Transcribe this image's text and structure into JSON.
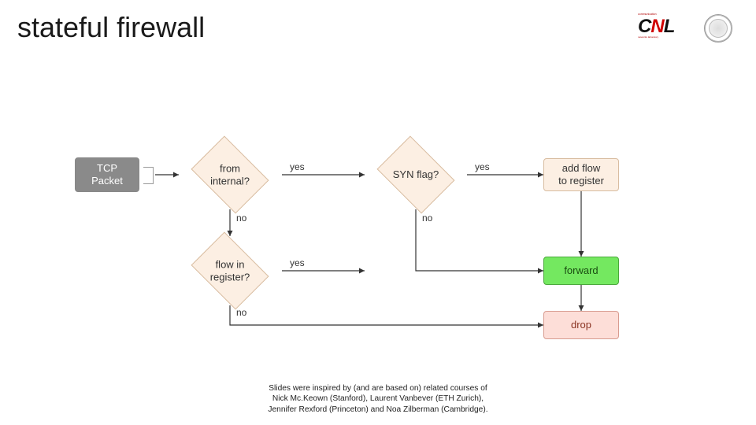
{
  "title": "stateful firewall",
  "logo": {
    "top_text": "communication",
    "name_c": "C",
    "name_n": "N",
    "name_l": "L",
    "sub_text": "networks laboratory"
  },
  "nodes": {
    "start": "TCP\nPacket",
    "decision_internal": "from\ninternal?",
    "decision_syn": "SYN flag?",
    "decision_register": "flow in\nregister?",
    "action_addflow": "add flow\nto register",
    "action_forward": "forward",
    "action_drop": "drop"
  },
  "edges": {
    "internal_yes": "yes",
    "internal_no": "no",
    "syn_yes": "yes",
    "syn_no": "no",
    "register_yes": "yes",
    "register_no": "no"
  },
  "footer": {
    "line1": "Slides were inspired by (and are based on) related courses of",
    "line2": "Nick Mc.Keown (Stanford), Laurent Vanbever (ETH Zurich),",
    "line3": "Jennifer Rexford (Princeton) and Noa Zilberman (Cambridge)."
  },
  "chart_data": {
    "type": "flowchart",
    "title": "stateful firewall",
    "nodes": [
      {
        "id": "start",
        "type": "start",
        "label": "TCP Packet"
      },
      {
        "id": "from_internal",
        "type": "decision",
        "label": "from internal?"
      },
      {
        "id": "syn_flag",
        "type": "decision",
        "label": "SYN flag?"
      },
      {
        "id": "flow_in_reg",
        "type": "decision",
        "label": "flow in register?"
      },
      {
        "id": "add_flow",
        "type": "process",
        "label": "add flow to register"
      },
      {
        "id": "forward",
        "type": "terminal",
        "label": "forward"
      },
      {
        "id": "drop",
        "type": "terminal",
        "label": "drop"
      }
    ],
    "edges": [
      {
        "from": "start",
        "to": "from_internal",
        "label": ""
      },
      {
        "from": "from_internal",
        "to": "syn_flag",
        "label": "yes"
      },
      {
        "from": "from_internal",
        "to": "flow_in_reg",
        "label": "no"
      },
      {
        "from": "syn_flag",
        "to": "add_flow",
        "label": "yes"
      },
      {
        "from": "syn_flag",
        "to": "forward",
        "label": "no"
      },
      {
        "from": "flow_in_reg",
        "to": "forward",
        "label": "yes"
      },
      {
        "from": "flow_in_reg",
        "to": "drop",
        "label": "no"
      },
      {
        "from": "add_flow",
        "to": "forward",
        "label": ""
      }
    ]
  }
}
